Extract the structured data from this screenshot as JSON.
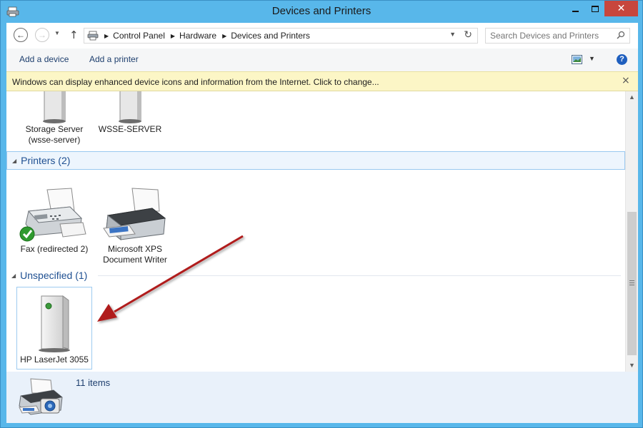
{
  "window": {
    "title": "Devices and Printers",
    "controls": {
      "minimize": "minimize-button",
      "maximize": "maximize-button",
      "close": "close-button"
    }
  },
  "address": {
    "crumbs": [
      "Control Panel",
      "Hardware",
      "Devices and Printers"
    ],
    "search_placeholder": "Search Devices and Printers"
  },
  "commands": {
    "add_device": "Add a device",
    "add_printer": "Add a printer"
  },
  "infobar": {
    "text": "Windows can display enhanced device icons and information from the Internet. Click to change...",
    "close": "×"
  },
  "groups": {
    "printers": {
      "title": "Printers (2)"
    },
    "unspecified": {
      "title": "Unspecified (1)"
    }
  },
  "devices": {
    "storage_server": {
      "line1": "Storage Server",
      "line2": "(wsse-server)"
    },
    "wsse_server": {
      "line1": "WSSE-SERVER"
    },
    "fax": {
      "line1": "Fax (redirected 2)"
    },
    "xps": {
      "line1": "Microsoft XPS",
      "line2": "Document Writer"
    },
    "hp": {
      "line1": "HP LaserJet 3055"
    }
  },
  "details": {
    "count": "11 items"
  },
  "colors": {
    "window_frame": "#58b7ea",
    "close_button": "#c7463d",
    "infobar_bg": "#fcf6c6",
    "group_title": "#1e4f91",
    "annotation_arrow": "#b01c1c"
  }
}
